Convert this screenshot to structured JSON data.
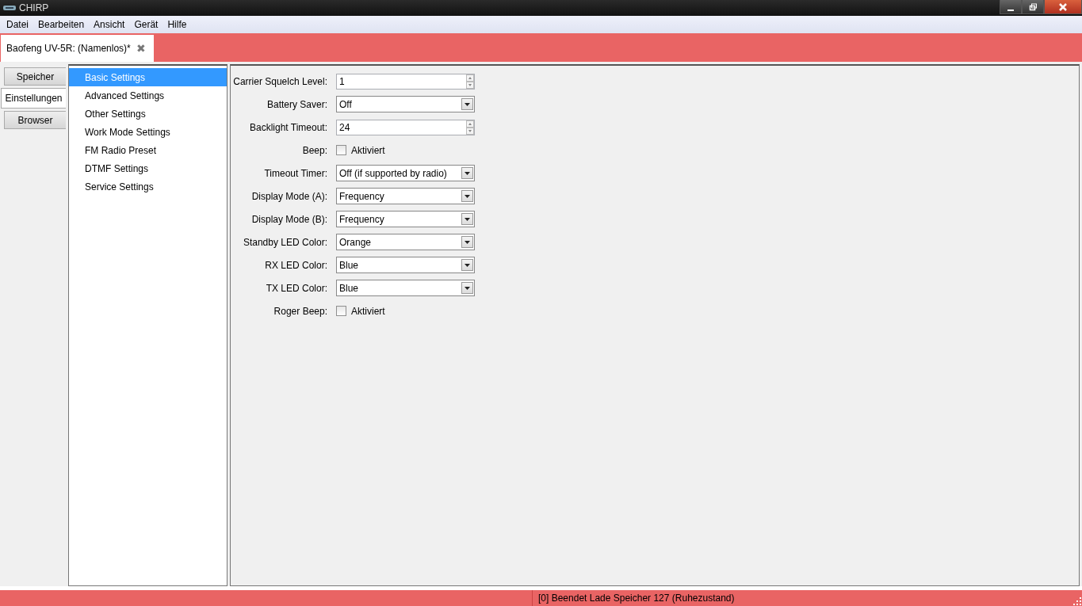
{
  "window": {
    "title": "CHIRP"
  },
  "menu": [
    "Datei",
    "Bearbeiten",
    "Ansicht",
    "Gerät",
    "Hilfe"
  ],
  "document_tab": {
    "label": "Baofeng UV-5R: (Namenlos)*",
    "close": "✖"
  },
  "side_tabs": [
    {
      "label": "Speicher",
      "selected": false
    },
    {
      "label": "Einstellungen",
      "selected": true
    },
    {
      "label": "Browser",
      "selected": false
    }
  ],
  "groups": [
    {
      "label": "Basic Settings",
      "selected": true
    },
    {
      "label": "Advanced Settings",
      "selected": false
    },
    {
      "label": "Other Settings",
      "selected": false
    },
    {
      "label": "Work Mode Settings",
      "selected": false
    },
    {
      "label": "FM Radio Preset",
      "selected": false
    },
    {
      "label": "DTMF Settings",
      "selected": false
    },
    {
      "label": "Service Settings",
      "selected": false
    }
  ],
  "settings": [
    {
      "label": "Carrier Squelch Level:",
      "kind": "spin",
      "value": "1"
    },
    {
      "label": "Battery Saver:",
      "kind": "combo",
      "value": "Off"
    },
    {
      "label": "Backlight Timeout:",
      "kind": "spin",
      "value": "24"
    },
    {
      "label": "Beep:",
      "kind": "check",
      "text": "Aktiviert",
      "checked": false
    },
    {
      "label": "Timeout Timer:",
      "kind": "combo",
      "value": "Off (if supported by radio)"
    },
    {
      "label": "Display Mode (A):",
      "kind": "combo",
      "value": "Frequency"
    },
    {
      "label": "Display Mode (B):",
      "kind": "combo",
      "value": "Frequency"
    },
    {
      "label": "Standby LED Color:",
      "kind": "combo",
      "value": "Orange"
    },
    {
      "label": "RX LED Color:",
      "kind": "combo",
      "value": "Blue"
    },
    {
      "label": "TX LED Color:",
      "kind": "combo",
      "value": "Blue"
    },
    {
      "label": "Roger Beep:",
      "kind": "check",
      "text": "Aktiviert",
      "checked": false
    }
  ],
  "status_bar": {
    "message": "[0] Beendet Lade Speicher 127 (Ruhezustand)"
  }
}
